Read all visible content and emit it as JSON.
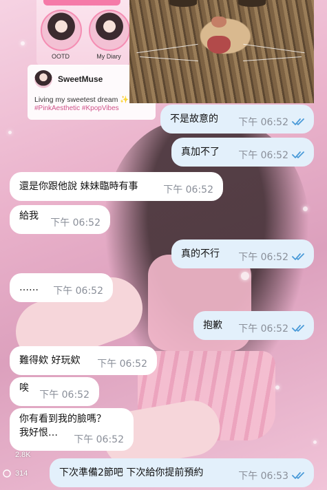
{
  "wallpaper": {
    "highlights": [
      {
        "label": "OOTD"
      },
      {
        "label": "My Diary"
      }
    ],
    "profile": {
      "name": "SweetMuse",
      "bio": "Living my sweetest dream",
      "tags": "#PinkAesthetic #KpopVibes"
    },
    "stats": {
      "likes": "2.8K",
      "comments": "314"
    }
  },
  "messages": [
    {
      "direction": "out",
      "text": "不是故意的",
      "time": "下午 06:52",
      "read": true
    },
    {
      "direction": "out",
      "text": "真加不了",
      "time": "下午 06:52",
      "read": true
    },
    {
      "direction": "in",
      "text": "還是你跟他說 妹妹臨時有事",
      "time": "下午 06:52"
    },
    {
      "direction": "in",
      "text": "給我",
      "time": "下午 06:52"
    },
    {
      "direction": "out",
      "text": "真的不行",
      "time": "下午 06:52",
      "read": true
    },
    {
      "direction": "in",
      "text": "……",
      "time": "下午 06:52"
    },
    {
      "direction": "out",
      "text": "抱歉",
      "time": "下午 06:52",
      "read": true
    },
    {
      "direction": "in",
      "text": "難得欸 好玩欸",
      "time": "下午 06:52"
    },
    {
      "direction": "in",
      "text": "唉",
      "time": "下午 06:52"
    },
    {
      "direction": "in",
      "text_line1": "你有看到我的臉嗎？",
      "text_line2": "我好恨…",
      "time": "下午 06:52"
    },
    {
      "direction": "out",
      "text": "下次準備2節吧  下次給你提前預約",
      "time": "下午 06:53",
      "read": true
    }
  ],
  "colors": {
    "outgoing_bubble": "#e3f0fb",
    "incoming_bubble": "#ffffff",
    "read_check": "#4a9ad8",
    "time_text": "#8a8f99"
  }
}
